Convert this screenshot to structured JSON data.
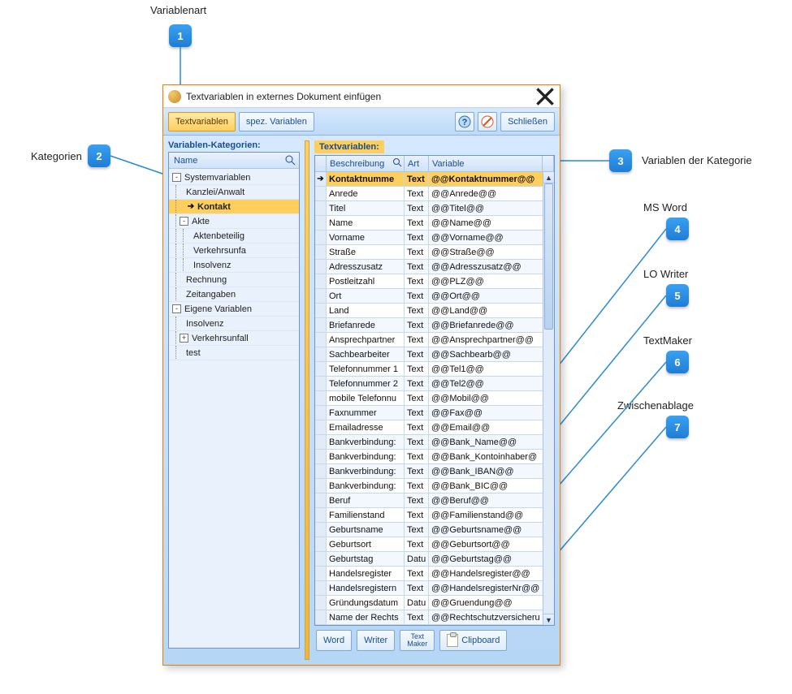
{
  "annotations": {
    "a1": {
      "num": "1",
      "label": "Variablenart"
    },
    "a2": {
      "num": "2",
      "label": "Kategorien"
    },
    "a3": {
      "num": "3",
      "label": "Variablen der Kategorie"
    },
    "a4": {
      "num": "4",
      "label": "MS Word"
    },
    "a5": {
      "num": "5",
      "label": "LO Writer"
    },
    "a6": {
      "num": "6",
      "label": "TextMaker"
    },
    "a7": {
      "num": "7",
      "label": "Zwischenablage"
    }
  },
  "dialog": {
    "title": "Textvariablen in externes Dokument einfügen",
    "toolbar": {
      "tab_textvariablen": "Textvariablen",
      "tab_spezvariablen": "spez. Variablen",
      "btn_close": "Schließen"
    },
    "left": {
      "panel_label": "Variablen-Kategorien:",
      "header": "Name"
    },
    "right": {
      "panel_label": "Textvariablen:",
      "headers": {
        "desc": "Beschreibung",
        "art": "Art",
        "var": "Variable"
      }
    },
    "bottom": {
      "word": "Word",
      "writer": "Writer",
      "textmaker1": "Text",
      "textmaker2": "Maker",
      "clipboard": "Clipboard"
    }
  },
  "tree": [
    {
      "label": "Systemvariablen",
      "indent": 0,
      "expander": "-"
    },
    {
      "label": "Kanzlei/Anwalt",
      "indent": 1
    },
    {
      "label": "Kontakt",
      "indent": 1,
      "selected": true,
      "arrow": true
    },
    {
      "label": "Akte",
      "indent": 1,
      "expander": "-"
    },
    {
      "label": "Aktenbeteilig",
      "indent": 2
    },
    {
      "label": "Verkehrsunfa",
      "indent": 2
    },
    {
      "label": "Insolvenz",
      "indent": 2
    },
    {
      "label": "Rechnung",
      "indent": 1
    },
    {
      "label": "Zeitangaben",
      "indent": 1
    },
    {
      "label": "Eigene Variablen",
      "indent": 0,
      "expander": "-"
    },
    {
      "label": "Insolvenz",
      "indent": 1
    },
    {
      "label": "Verkehrsunfall",
      "indent": 1,
      "expander": "+"
    },
    {
      "label": "test",
      "indent": 1
    }
  ],
  "grid": [
    {
      "d": "Kontaktnumme",
      "a": "Text",
      "v": "@@Kontaktnummer@@",
      "sel": true
    },
    {
      "d": "Anrede",
      "a": "Text",
      "v": "@@Anrede@@"
    },
    {
      "d": "Titel",
      "a": "Text",
      "v": "@@Titel@@"
    },
    {
      "d": "Name",
      "a": "Text",
      "v": "@@Name@@"
    },
    {
      "d": "Vorname",
      "a": "Text",
      "v": "@@Vorname@@"
    },
    {
      "d": "Straße",
      "a": "Text",
      "v": "@@Straße@@"
    },
    {
      "d": "Adresszusatz",
      "a": "Text",
      "v": "@@Adresszusatz@@"
    },
    {
      "d": "Postleitzahl",
      "a": "Text",
      "v": "@@PLZ@@"
    },
    {
      "d": "Ort",
      "a": "Text",
      "v": "@@Ort@@"
    },
    {
      "d": "Land",
      "a": "Text",
      "v": "@@Land@@"
    },
    {
      "d": "Briefanrede",
      "a": "Text",
      "v": "@@Briefanrede@@"
    },
    {
      "d": "Ansprechpartner",
      "a": "Text",
      "v": "@@Ansprechpartner@@"
    },
    {
      "d": "Sachbearbeiter",
      "a": "Text",
      "v": "@@Sachbearb@@"
    },
    {
      "d": "Telefonnummer 1",
      "a": "Text",
      "v": "@@Tel1@@"
    },
    {
      "d": "Telefonnummer 2",
      "a": "Text",
      "v": "@@Tel2@@"
    },
    {
      "d": "mobile Telefonnu",
      "a": "Text",
      "v": "@@Mobil@@"
    },
    {
      "d": "Faxnummer",
      "a": "Text",
      "v": "@@Fax@@"
    },
    {
      "d": "Emailadresse",
      "a": "Text",
      "v": "@@Email@@"
    },
    {
      "d": "Bankverbindung:",
      "a": "Text",
      "v": "@@Bank_Name@@"
    },
    {
      "d": "Bankverbindung:",
      "a": "Text",
      "v": "@@Bank_Kontoinhaber@"
    },
    {
      "d": "Bankverbindung:",
      "a": "Text",
      "v": "@@Bank_IBAN@@"
    },
    {
      "d": "Bankverbindung:",
      "a": "Text",
      "v": "@@Bank_BIC@@"
    },
    {
      "d": "Beruf",
      "a": "Text",
      "v": "@@Beruf@@"
    },
    {
      "d": "Familienstand",
      "a": "Text",
      "v": "@@Familienstand@@"
    },
    {
      "d": "Geburtsname",
      "a": "Text",
      "v": "@@Geburtsname@@"
    },
    {
      "d": "Geburtsort",
      "a": "Text",
      "v": "@@Geburtsort@@"
    },
    {
      "d": "Geburtstag",
      "a": "Datu",
      "v": "@@Geburtstag@@"
    },
    {
      "d": "Handelsregister",
      "a": "Text",
      "v": "@@Handelsregister@@"
    },
    {
      "d": "Handelsregistern",
      "a": "Text",
      "v": "@@HandelsregisterNr@@"
    },
    {
      "d": "Gründungsdatum",
      "a": "Datu",
      "v": "@@Gruendung@@"
    },
    {
      "d": "Name der Rechts",
      "a": "Text",
      "v": "@@Rechtschutzversicheru"
    }
  ]
}
